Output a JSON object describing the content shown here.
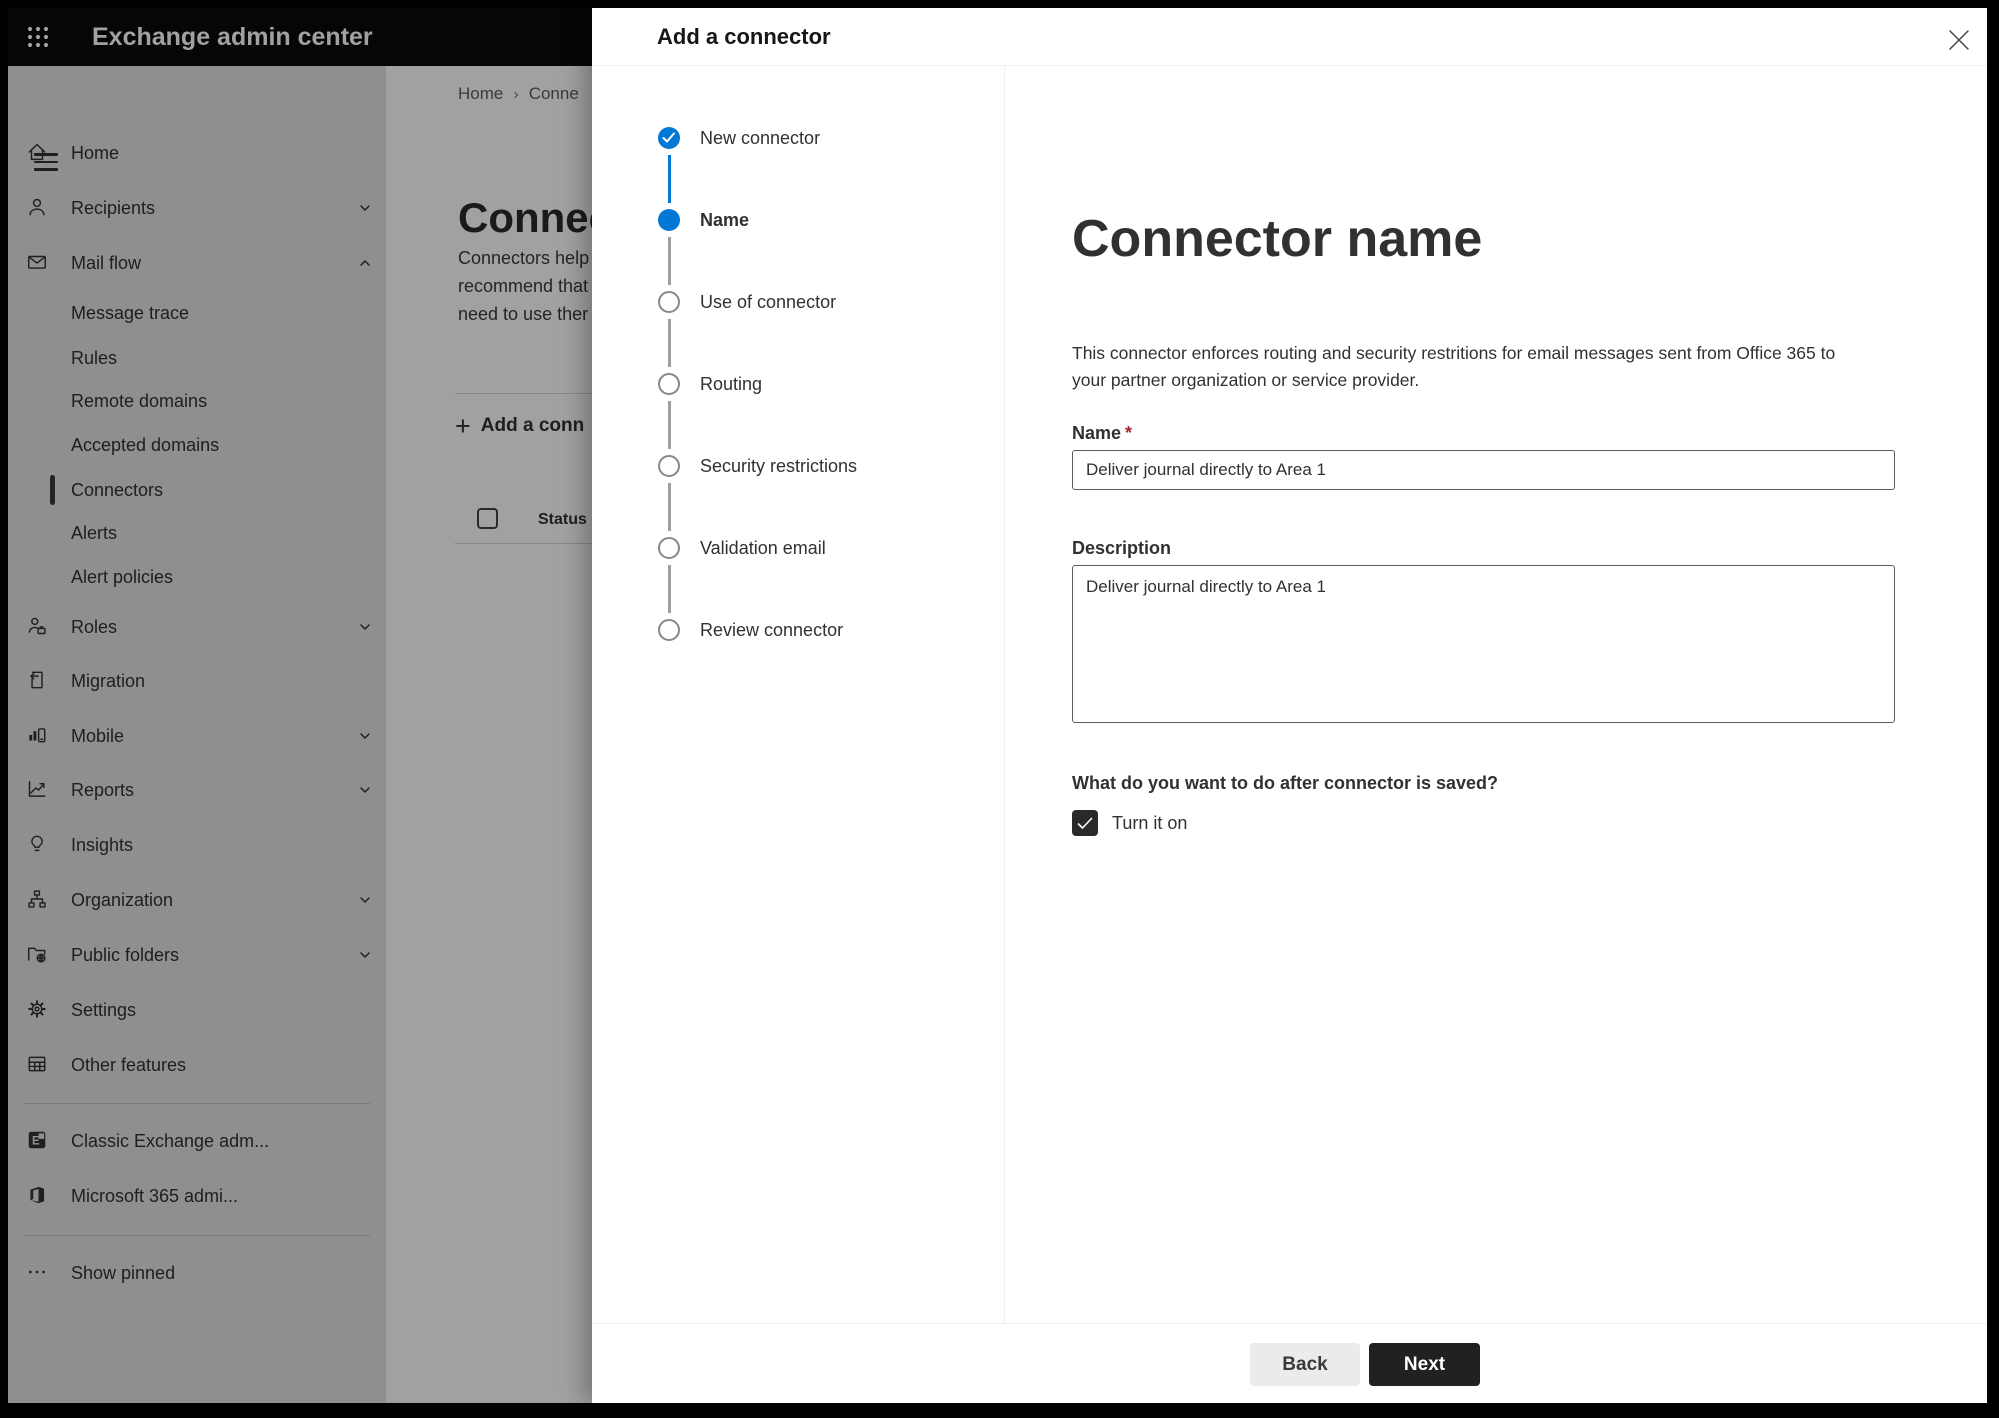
{
  "header": {
    "app_title": "Exchange admin center"
  },
  "sidebar": {
    "items": [
      {
        "label": "Home",
        "icon": "home"
      },
      {
        "label": "Recipients",
        "icon": "person",
        "expandable": true
      },
      {
        "label": "Mail flow",
        "icon": "mail",
        "expandable": true,
        "expanded": true
      },
      {
        "label": "Message trace",
        "child": true
      },
      {
        "label": "Rules",
        "child": true
      },
      {
        "label": "Remote domains",
        "child": true
      },
      {
        "label": "Accepted domains",
        "child": true
      },
      {
        "label": "Connectors",
        "child": true,
        "selected": true
      },
      {
        "label": "Alerts",
        "child": true
      },
      {
        "label": "Alert policies",
        "child": true
      },
      {
        "label": "Roles",
        "icon": "roles",
        "expandable": true
      },
      {
        "label": "Migration",
        "icon": "migration"
      },
      {
        "label": "Mobile",
        "icon": "mobile",
        "expandable": true
      },
      {
        "label": "Reports",
        "icon": "reports",
        "expandable": true
      },
      {
        "label": "Insights",
        "icon": "insights"
      },
      {
        "label": "Organization",
        "icon": "organization",
        "expandable": true
      },
      {
        "label": "Public folders",
        "icon": "public-folders",
        "expandable": true
      },
      {
        "label": "Settings",
        "icon": "settings"
      },
      {
        "label": "Other features",
        "icon": "other-features"
      },
      {
        "label": "Classic Exchange adm...",
        "icon": "classic-exchange"
      },
      {
        "label": "Microsoft 365 admi...",
        "icon": "microsoft-365"
      },
      {
        "label": "Show pinned",
        "icon": "more"
      }
    ]
  },
  "background_page": {
    "breadcrumb": {
      "home": "Home",
      "current": "Conne"
    },
    "title_fragment": "Connect",
    "paragraph_lines": [
      "Connectors help",
      "recommend that",
      "need to use ther"
    ],
    "add_button_label": "Add a conn",
    "column_header_status": "Status"
  },
  "modal": {
    "title": "Add a connector",
    "steps": [
      {
        "label": "New connector",
        "state": "completed"
      },
      {
        "label": "Name",
        "state": "current"
      },
      {
        "label": "Use of connector",
        "state": "upcoming"
      },
      {
        "label": "Routing",
        "state": "upcoming"
      },
      {
        "label": "Security restrictions",
        "state": "upcoming"
      },
      {
        "label": "Validation email",
        "state": "upcoming"
      },
      {
        "label": "Review connector",
        "state": "upcoming"
      }
    ],
    "content": {
      "heading": "Connector name",
      "description": "This connector enforces routing and security restritions for email messages sent from Office 365 to your partner organization or service provider.",
      "name_label": "Name",
      "required_marker": "*",
      "name_value": "Deliver journal directly to Area 1",
      "description_label": "Description",
      "description_value": "Deliver journal directly to Area 1",
      "question": "What do you want to do after connector is saved?",
      "turn_on_label": "Turn it on",
      "turn_on_checked": true
    },
    "footer": {
      "back_label": "Back",
      "next_label": "Next"
    }
  },
  "colors": {
    "accent_blue": "#0078d4",
    "checked_checkbox_dark": "#2b2a29",
    "primary_button_bg": "#222120",
    "required_red": "#a4262c"
  }
}
